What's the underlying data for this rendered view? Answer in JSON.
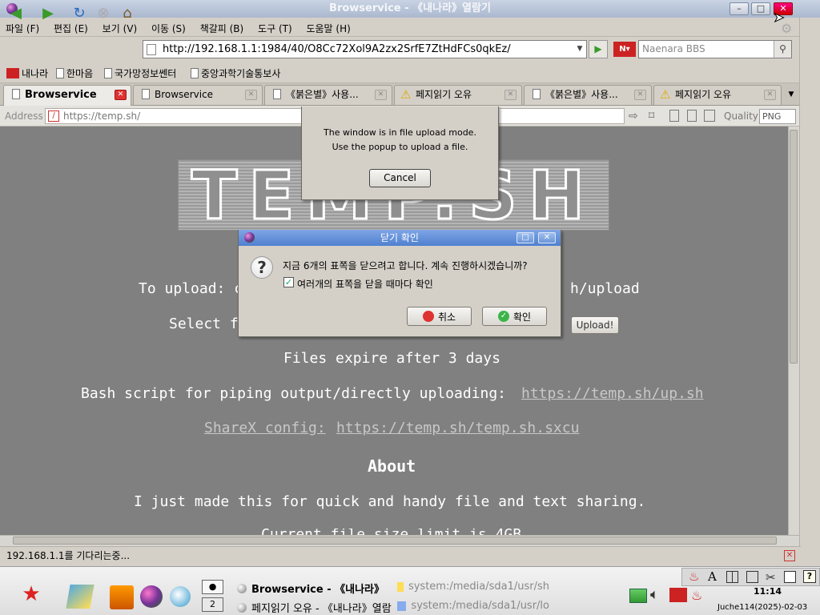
{
  "window": {
    "title": "Browservice - 《내나라》열람기"
  },
  "menu": [
    "파일 (F)",
    "편집 (E)",
    "보기 (V)",
    "이동 (S)",
    "책갈피 (B)",
    "도구 (T)",
    "도움말 (H)"
  ],
  "nav": {
    "url": "http://192.168.1.1:1984/40/O8Cc72Xol9A2zx2SrfE7ZtHdFCs0qkEz/",
    "search_placeholder": "Naenara BBS"
  },
  "bookmarks": [
    "내나라",
    "한마음",
    "국가망정보쎈터",
    "중앙과학기술통보사"
  ],
  "tabs": [
    "Browservice",
    "Browservice",
    "《붉은별》사용...",
    "페지읽기 오유",
    "《붉은별》사용...",
    "페지읽기 오유"
  ],
  "addr": {
    "label": "Address",
    "value": "https://temp.sh/",
    "quality_label": "Quality",
    "quality_value": "PNG"
  },
  "page": {
    "logo": "TEMP.SH",
    "upload_prefix": "To upload: c",
    "upload_suffix": "h/upload",
    "select_prefix": "Select f",
    "upload_btn": "Upload!",
    "expire": "Files expire after 3 days",
    "bash_label": "Bash script for piping output/directly uploading:",
    "bash_link": "https://temp.sh/up.sh",
    "sharex_label": "ShareX config:",
    "sharex_link": "https://temp.sh/temp.sh.sxcu",
    "about": "About",
    "about_text": "I just made this for quick and handy file and text sharing.",
    "cutoff": "Current file size limit is 4GB"
  },
  "upload_dialog": {
    "line1": "The window is in file upload mode.",
    "line2": "Use the popup to upload a file.",
    "cancel": "Cancel"
  },
  "confirm_dialog": {
    "title": "닫기 확인",
    "message": "지금 6개의 표쪽을 닫으려고 합니다. 계속 진행하시겠습니까?",
    "checkbox": "여러개의 표쪽을 닫을 때마다 확인",
    "cancel": "취소",
    "ok": "확인"
  },
  "status": {
    "text": "192.168.1.1를 기다리는중..."
  },
  "taskbar": {
    "desktop_num": "2",
    "task1": "Browservice - 《내나라》",
    "task1b": "system:/media/sda1/usr/sh",
    "task2": "페지읽기 오유 - 《내나라》열람",
    "task2b": "system:/media/sda1/usr/lo",
    "clock": "11:14",
    "date": "Juche114(2025)-02-03"
  },
  "colors": {
    "content_bg": "#808080",
    "dialog_title": "#5a87d6",
    "ok_green": "#3bb54a",
    "cancel_red": "#d33"
  }
}
